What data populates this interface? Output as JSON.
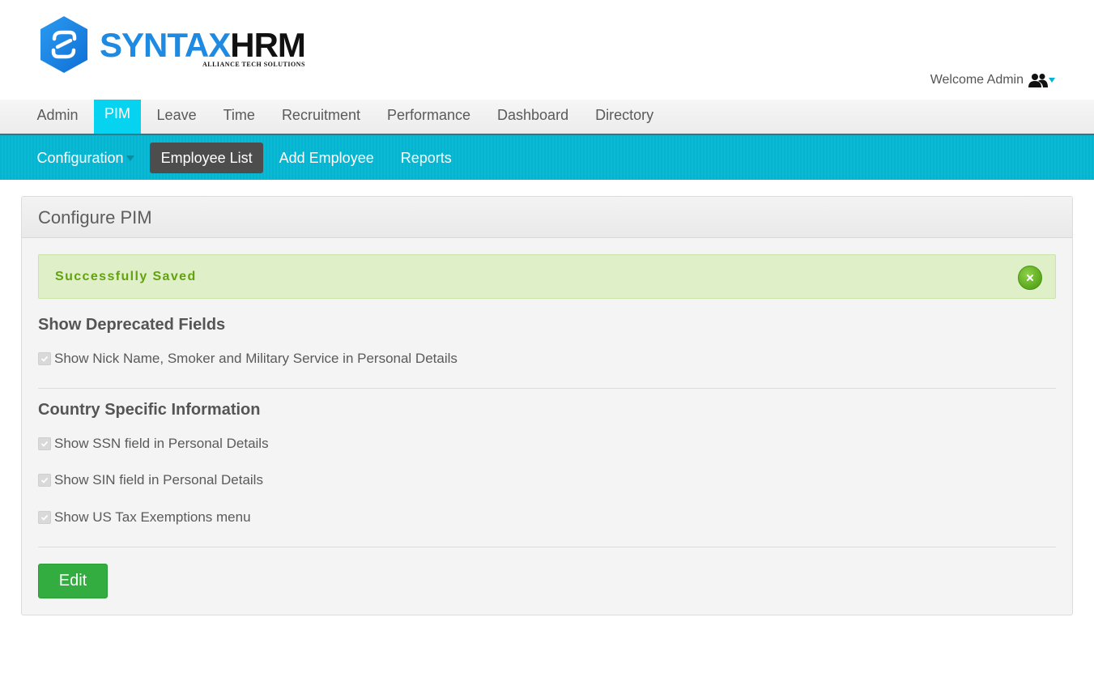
{
  "header": {
    "logo": {
      "brand_part1": "SYNTAX",
      "brand_part2": "HRM",
      "tagline": "ALLIANCE TECH SOLUTIONS",
      "icon": "syntax-logo-mark"
    },
    "welcome_text": "Welcome Admin",
    "user_icon": "users-icon",
    "dropdown_icon": "caret-down-icon"
  },
  "main_nav": {
    "items": [
      {
        "label": "Admin",
        "active": false
      },
      {
        "label": "PIM",
        "active": true
      },
      {
        "label": "Leave",
        "active": false
      },
      {
        "label": "Time",
        "active": false
      },
      {
        "label": "Recruitment",
        "active": false
      },
      {
        "label": "Performance",
        "active": false
      },
      {
        "label": "Dashboard",
        "active": false
      },
      {
        "label": "Directory",
        "active": false
      }
    ]
  },
  "sub_nav": {
    "items": [
      {
        "label": "Configuration",
        "has_dropdown": true,
        "active": false
      },
      {
        "label": "Employee List",
        "has_dropdown": false,
        "active": true
      },
      {
        "label": "Add Employee",
        "has_dropdown": false,
        "active": false
      },
      {
        "label": "Reports",
        "has_dropdown": false,
        "active": false
      }
    ]
  },
  "panel": {
    "title": "Configure PIM",
    "alert": {
      "message": "Successfully Saved",
      "close_icon": "close-icon"
    },
    "sections": [
      {
        "title": "Show Deprecated Fields",
        "options": [
          {
            "label": "Show Nick Name, Smoker and Military Service in Personal Details",
            "checked": true,
            "disabled": true
          }
        ]
      },
      {
        "title": "Country Specific Information",
        "options": [
          {
            "label": "Show SSN field in Personal Details",
            "checked": true,
            "disabled": true
          },
          {
            "label": "Show SIN field in Personal Details",
            "checked": true,
            "disabled": true
          },
          {
            "label": "Show US Tax Exemptions menu",
            "checked": true,
            "disabled": true
          }
        ]
      }
    ],
    "edit_label": "Edit"
  },
  "colors": {
    "brand_blue": "#1e8ae2",
    "nav_active": "#06d3f0",
    "subnav_bg": "#06b4cf",
    "subnav_active": "#4d4d4d",
    "alert_bg": "#dff0c8",
    "alert_text": "#63a20e",
    "edit_button": "#33ad3f"
  }
}
